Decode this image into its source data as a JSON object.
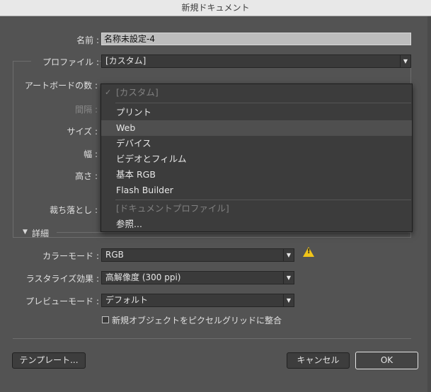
{
  "window": {
    "title": "新規ドキュメント"
  },
  "name_field": {
    "label": "名前 :",
    "value": "名称未設定-4"
  },
  "profile": {
    "label": "プロファイル :",
    "value": "[カスタム]",
    "options": [
      {
        "label": "[カスタム]",
        "checked": true,
        "disabled": true
      },
      {
        "label": "プリント"
      },
      {
        "label": "Web",
        "highlighted": true
      },
      {
        "label": "デバイス"
      },
      {
        "label": "ビデオとフィルム"
      },
      {
        "label": "基本 RGB"
      },
      {
        "label": "Flash Builder"
      },
      {
        "label": "[ドキュメントプロファイル]",
        "disabled": true
      },
      {
        "label": "参照..."
      }
    ]
  },
  "fields": {
    "artboards_label": "アートボードの数 :",
    "spacing_label": "間隔 :",
    "size_label": "サイズ :",
    "width_label": "幅 :",
    "height_label": "高さ :",
    "bleed_label": "裁ち落とし :"
  },
  "advanced": {
    "label": "詳細",
    "color_mode_label": "カラーモード :",
    "color_mode_value": "RGB",
    "raster_label": "ラスタライズ効果 :",
    "raster_value": "高解像度 (300 ppi)",
    "preview_label": "プレビューモード :",
    "preview_value": "デフォルト",
    "align_pixel_label": "新規オブジェクトをピクセルグリッドに整合",
    "warning_icon": "warning-icon"
  },
  "buttons": {
    "template": "テンプレート...",
    "cancel": "キャンセル",
    "ok": "OK"
  },
  "colors": {
    "warning": "#f0c419",
    "background": "#535353"
  }
}
